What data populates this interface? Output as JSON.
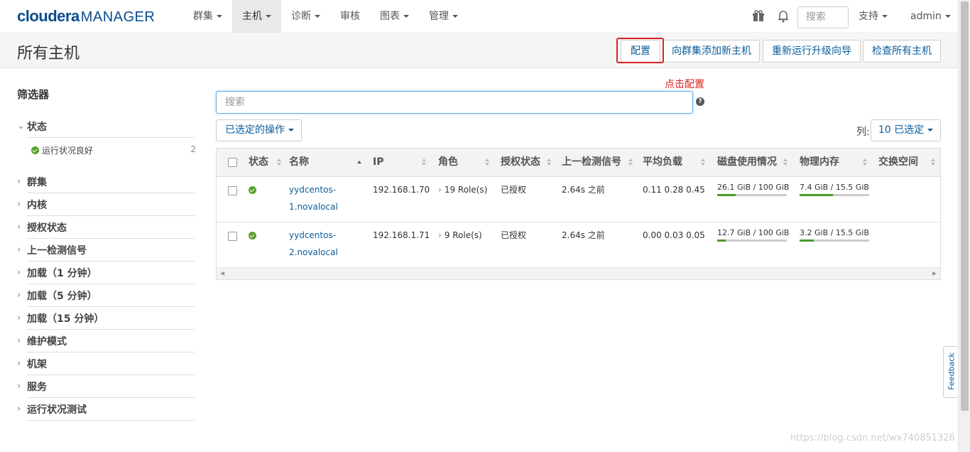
{
  "brand": {
    "part1": "cloudera",
    "part2": "MANAGER",
    "color": "#0a4c8f"
  },
  "nav": [
    {
      "label": "群集",
      "has_dropdown": true
    },
    {
      "label": "主机",
      "has_dropdown": true,
      "active": true
    },
    {
      "label": "诊断",
      "has_dropdown": true
    },
    {
      "label": "审核",
      "has_dropdown": false
    },
    {
      "label": "图表",
      "has_dropdown": true
    },
    {
      "label": "管理",
      "has_dropdown": true
    }
  ],
  "top_right": {
    "search_placeholder": "搜索",
    "support": "支持",
    "user": "admin",
    "icons": [
      "gift-icon",
      "bell-icon"
    ]
  },
  "page": {
    "title": "所有主机"
  },
  "header_buttons": {
    "configure": "配置",
    "add_host": "向群集添加新主机",
    "rerun_wizard": "重新运行升级向导",
    "inspect_all": "检查所有主机"
  },
  "annotation": "点击配置",
  "sidebar": {
    "title": "筛选器",
    "facets": [
      {
        "label": "状态",
        "expanded": true
      },
      {
        "label": "群集"
      },
      {
        "label": "内核"
      },
      {
        "label": "授权状态"
      },
      {
        "label": "上一检测信号"
      },
      {
        "label": "加载（1 分钟）"
      },
      {
        "label": "加载（5 分钟）"
      },
      {
        "label": "加载（15 分钟）"
      },
      {
        "label": "维护模式"
      },
      {
        "label": "机架"
      },
      {
        "label": "服务"
      },
      {
        "label": "运行状况测试"
      }
    ],
    "status_option": {
      "label": "运行状况良好",
      "count": "2"
    }
  },
  "main": {
    "search_placeholder": "搜索",
    "selected_actions": "已选定的操作",
    "columns_label": "列:",
    "columns_selected": "10 已选定"
  },
  "table": {
    "headers": [
      "状态",
      "名称",
      "IP",
      "角色",
      "授权状态",
      "上一检测信号",
      "平均负载",
      "磁盘使用情况",
      "物理内存",
      "交换空间"
    ],
    "rows": [
      {
        "name_line1": "yydcentos-",
        "name_line2": "1.novalocal",
        "ip": "192.168.1.70",
        "roles": "19 Role(s)",
        "auth": "已授权",
        "heartbeat": "2.64s 之前",
        "load": "0.11  0.28  0.45",
        "disk": "26.1 GiB / 100 GiB",
        "disk_frac": 0.261,
        "mem": "7.4 GiB / 15.5 GiB",
        "mem_frac": 0.477
      },
      {
        "name_line1": "yydcentos-",
        "name_line2": "2.novalocal",
        "ip": "192.168.1.71",
        "roles": "9 Role(s)",
        "auth": "已授权",
        "heartbeat": "2.64s 之前",
        "load": "0.00  0.03  0.05",
        "disk": "12.7 GiB / 100 GiB",
        "disk_frac": 0.127,
        "mem": "3.2 GiB / 15.5 GiB",
        "mem_frac": 0.206
      }
    ]
  },
  "feedback": "Feedback",
  "watermark": "https://blog.csdn.net/wx740851326",
  "colors": {
    "link": "#0a5c99",
    "ok": "#5aa02c",
    "highlight": "#e02020",
    "bar_fill": "#4a9a2c"
  }
}
